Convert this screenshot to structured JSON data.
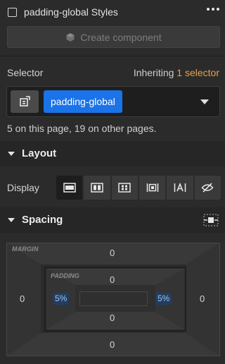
{
  "header": {
    "title": "padding-global Styles",
    "more_icon": "more-horizontal-icon"
  },
  "create_component": {
    "label": "Create component",
    "icon": "component-cube-icon"
  },
  "selector": {
    "label": "Selector",
    "inheriting_prefix": "Inheriting",
    "inheriting_count": "1 selector",
    "tag": "padding-global",
    "usage": "5 on this page, 19 on other pages."
  },
  "layout": {
    "section_label": "Layout",
    "display_label": "Display",
    "display_options": [
      {
        "name": "block",
        "active": true
      },
      {
        "name": "flex",
        "active": false
      },
      {
        "name": "grid",
        "active": false
      },
      {
        "name": "inline-block",
        "active": false
      },
      {
        "name": "inline",
        "active": false
      },
      {
        "name": "none",
        "active": false
      }
    ]
  },
  "spacing": {
    "section_label": "Spacing",
    "margin_label": "MARGIN",
    "padding_label": "PADDING",
    "margin": {
      "top": "0",
      "right": "0",
      "bottom": "0",
      "left": "0"
    },
    "padding": {
      "top": "0",
      "right": "5%",
      "bottom": "0",
      "left": "5%"
    }
  },
  "colors": {
    "accent": "#1a73e8",
    "inherit": "#e7a24b",
    "panel": "#2b2b2b"
  }
}
